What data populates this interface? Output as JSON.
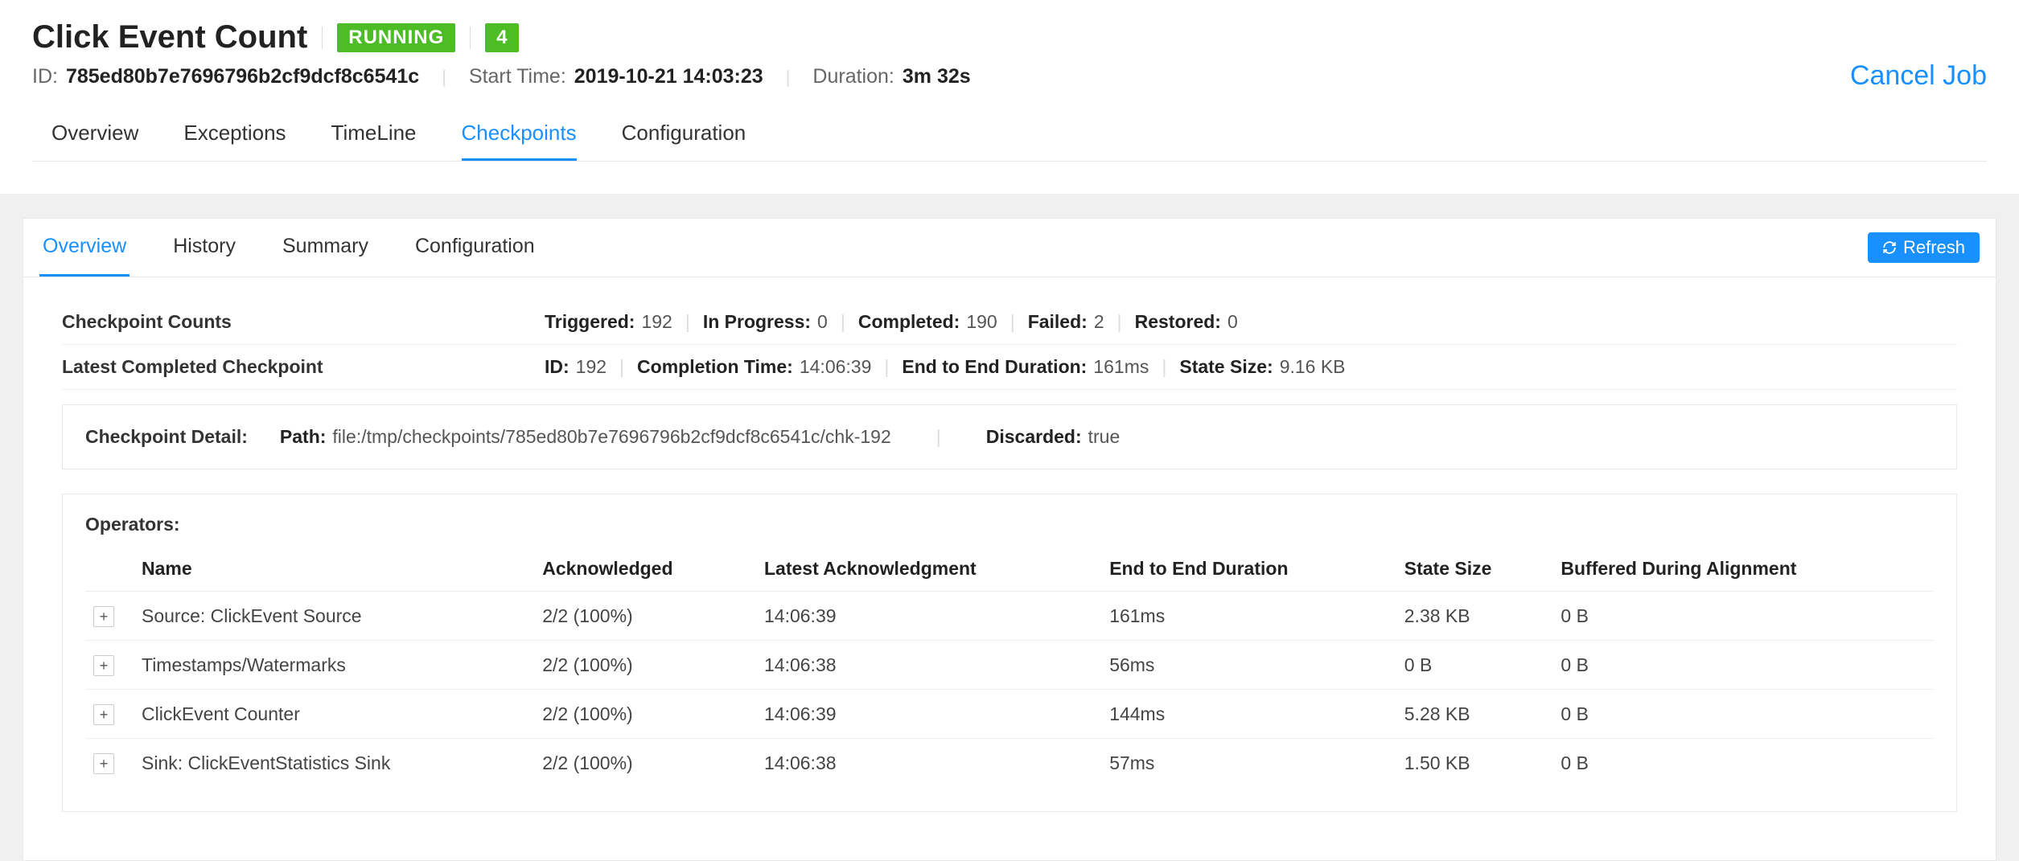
{
  "header": {
    "title": "Click Event Count",
    "status_label": "RUNNING",
    "parallelism": "4",
    "id_label": "ID:",
    "id_value": "785ed80b7e7696796b2cf9dcf8c6541c",
    "start_label": "Start Time:",
    "start_value": "2019-10-21 14:03:23",
    "duration_label": "Duration:",
    "duration_value": "3m 32s",
    "cancel_label": "Cancel Job"
  },
  "tabs_main": {
    "t0": "Overview",
    "t1": "Exceptions",
    "t2": "TimeLine",
    "t3": "Checkpoints",
    "t4": "Configuration"
  },
  "tabs_sub": {
    "t0": "Overview",
    "t1": "History",
    "t2": "Summary",
    "t3": "Configuration",
    "refresh": "Refresh"
  },
  "counts": {
    "label": "Checkpoint Counts",
    "triggered_k": "Triggered:",
    "triggered_v": "192",
    "inprogress_k": "In Progress:",
    "inprogress_v": "0",
    "completed_k": "Completed:",
    "completed_v": "190",
    "failed_k": "Failed:",
    "failed_v": "2",
    "restored_k": "Restored:",
    "restored_v": "0"
  },
  "latest": {
    "label": "Latest Completed Checkpoint",
    "id_k": "ID:",
    "id_v": "192",
    "comp_k": "Completion Time:",
    "comp_v": "14:06:39",
    "e2e_k": "End to End Duration:",
    "e2e_v": "161ms",
    "size_k": "State Size:",
    "size_v": "9.16 KB"
  },
  "detail": {
    "label": "Checkpoint Detail:",
    "path_k": "Path:",
    "path_v": "file:/tmp/checkpoints/785ed80b7e7696796b2cf9dcf8c6541c/chk-192",
    "disc_k": "Discarded:",
    "disc_v": "true"
  },
  "ops": {
    "title": "Operators:",
    "h_name": "Name",
    "h_ack": "Acknowledged",
    "h_latest": "Latest Acknowledgment",
    "h_e2e": "End to End Duration",
    "h_size": "State Size",
    "h_buf": "Buffered During Alignment",
    "rows": [
      {
        "name": "Source: ClickEvent Source",
        "ack": "2/2 (100%)",
        "latest": "14:06:39",
        "e2e": "161ms",
        "size": "2.38 KB",
        "buf": "0 B"
      },
      {
        "name": "Timestamps/Watermarks",
        "ack": "2/2 (100%)",
        "latest": "14:06:38",
        "e2e": "56ms",
        "size": "0 B",
        "buf": "0 B"
      },
      {
        "name": "ClickEvent Counter",
        "ack": "2/2 (100%)",
        "latest": "14:06:39",
        "e2e": "144ms",
        "size": "5.28 KB",
        "buf": "0 B"
      },
      {
        "name": "Sink: ClickEventStatistics Sink",
        "ack": "2/2 (100%)",
        "latest": "14:06:38",
        "e2e": "57ms",
        "size": "1.50 KB",
        "buf": "0 B"
      }
    ]
  }
}
